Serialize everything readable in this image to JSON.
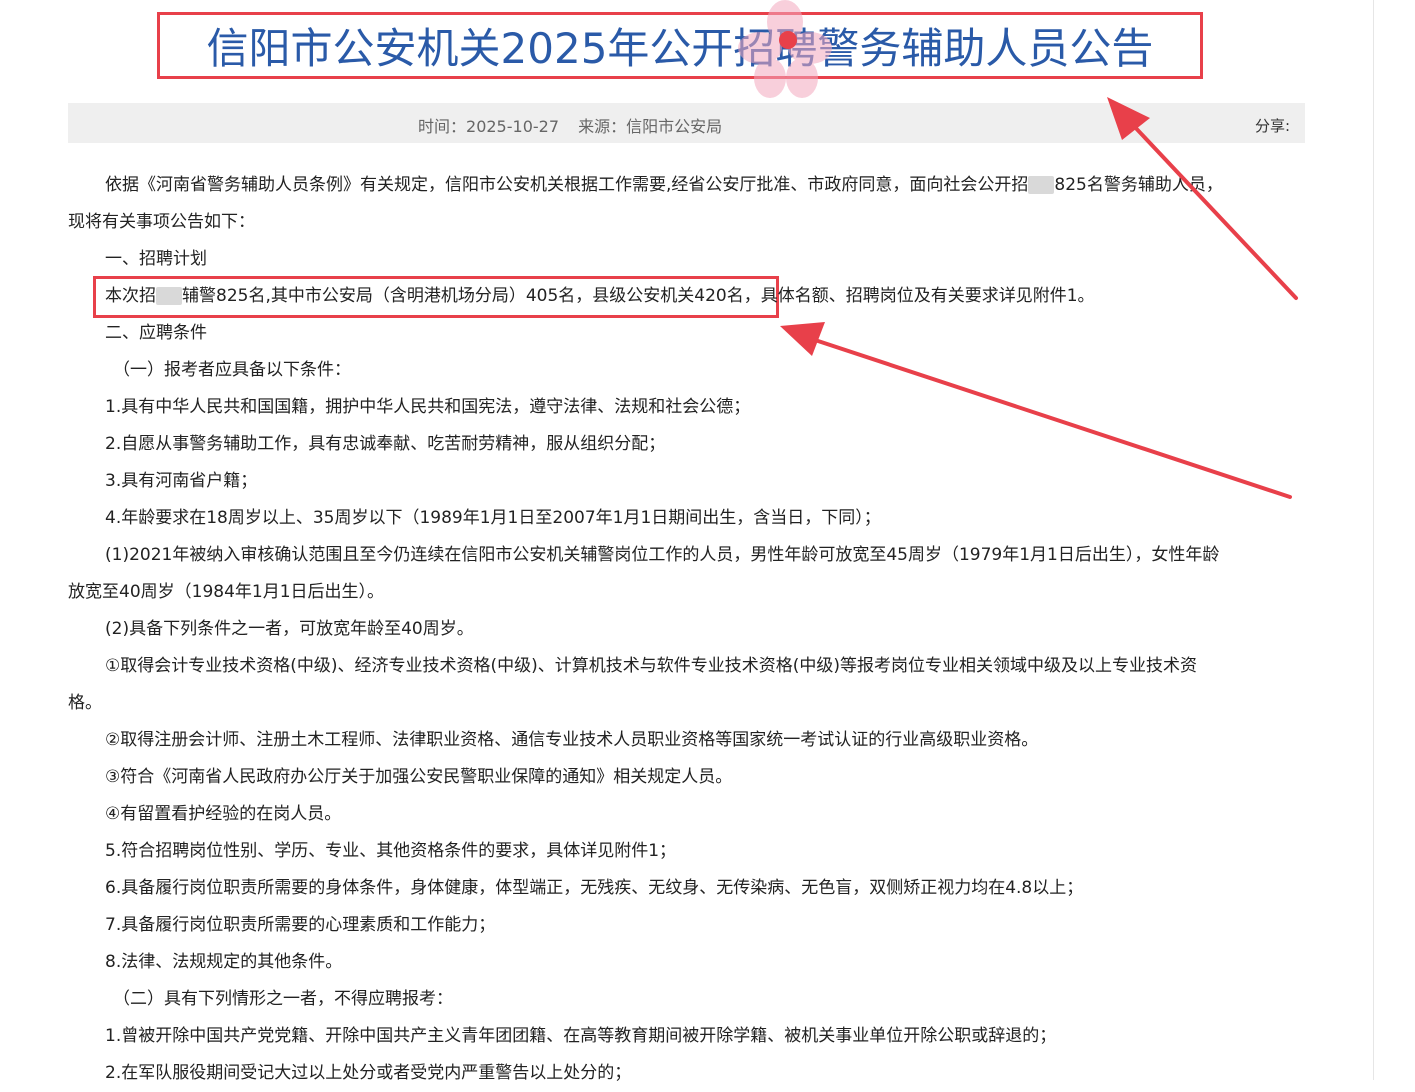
{
  "article": {
    "title": "信阳市公安机关2025年公开招聘警务辅助人员公告",
    "time_label": "时间：",
    "time_value": "2025-10-27",
    "source_label": "来源：",
    "source_value": "信阳市公安局",
    "share_label": "分享:"
  },
  "body": {
    "l1a": "依据《河南省警务辅助人员条例》有关规定，信阳市公安机关根据工作需要,经省公安厅批准、市政府同意，面向社会公开招",
    "l1b": "825名警务辅助人员，",
    "l2": "现将有关事项公告如下：",
    "l3": "一、招聘计划",
    "l4a": "本次招",
    "l4b": "辅警825名,其中市公安局（含明港机场分局）405名，县级公安机关420名，具体名额、招聘岗位及有关要求详见附件1。",
    "l5": "二、应聘条件",
    "l6": "（一）报考者应具备以下条件：",
    "l7": "1.具有中华人民共和国国籍，拥护中华人民共和国宪法，遵守法律、法规和社会公德；",
    "l8": "2.自愿从事警务辅助工作，具有忠诚奉献、吃苦耐劳精神，服从组织分配；",
    "l9": "3.具有河南省户籍；",
    "l10": "4.年龄要求在18周岁以上、35周岁以下（1989年1月1日至2007年1月1日期间出生，含当日，下同）；",
    "l11": "(1)2021年被纳入审核确认范围且至今仍连续在信阳市公安机关辅警岗位工作的人员，男性年龄可放宽至45周岁（1979年1月1日后出生），女性年龄",
    "l12": "放宽至40周岁（1984年1月1日后出生）。",
    "l13": "(2)具备下列条件之一者，可放宽年龄至40周岁。",
    "l14": "①取得会计专业技术资格(中级)、经济专业技术资格(中级)、计算机技术与软件专业技术资格(中级)等报考岗位专业相关领域中级及以上专业技术资",
    "l15": "格。",
    "l16": "②取得注册会计师、注册土木工程师、法律职业资格、通信专业技术人员职业资格等国家统一考试认证的行业高级职业资格。",
    "l17": "③符合《河南省人民政府办公厅关于加强公安民警职业保障的通知》相关规定人员。",
    "l18": "④有留置看护经验的在岗人员。",
    "l19": "5.符合招聘岗位性别、学历、专业、其他资格条件的要求，具体详见附件1；",
    "l20": "6.具备履行岗位职责所需要的身体条件，身体健康，体型端正，无残疾、无纹身、无传染病、无色盲，双侧矫正视力均在4.8以上；",
    "l21": "7.具备履行岗位职责所需要的心理素质和工作能力；",
    "l22": "8.法律、法规规定的其他条件。",
    "l23": "（二）具有下列情形之一者，不得应聘报考：",
    "l24": "1.曾被开除中国共产党党籍、开除中国共产主义青年团团籍、在高等教育期间被开除学籍、被机关事业单位开除公职或辞退的；",
    "l25": "2.在军队服役期间受记大过以上处分或者受党内严重警告以上处分的；"
  },
  "colors": {
    "title_blue": "#2a5aa8",
    "annotation_red": "#e8404a",
    "meta_bg": "#efefef"
  }
}
